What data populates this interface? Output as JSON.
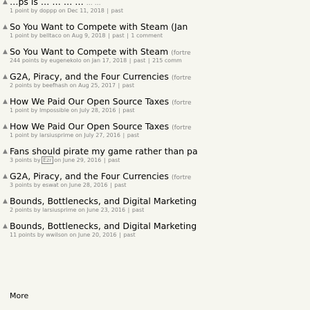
{
  "stories": [
    {
      "title": "…ps is … …  …  …",
      "site": "… …",
      "points": "1 point",
      "user": "doppp",
      "age": "on Dec 11, 2018",
      "comments": "past",
      "extra": ""
    },
    {
      "title": "So You Want to Compete with Steam (Jan",
      "site": "",
      "points": "1 point",
      "user": "belltaco",
      "age": "on Aug 9, 2018",
      "comments": "past",
      "extra": "1 comment"
    },
    {
      "title": "So You Want to Compete with Steam",
      "site": "(fortre",
      "points": "244 points",
      "user": "eugenekolo",
      "age": "on Jan 17, 2018",
      "comments": "past",
      "extra": "215 comm"
    },
    {
      "title": "G2A, Piracy, and the Four Currencies",
      "site": "(fortre",
      "points": "2 points",
      "user": "beefhash",
      "age": "on Aug 25, 2017",
      "comments": "past",
      "extra": ""
    },
    {
      "title": "How We Paid Our Open Source Taxes",
      "site": "(fortre",
      "points": "1 point",
      "user": "Impossible",
      "age": "on July 28, 2016",
      "comments": "past",
      "extra": ""
    },
    {
      "title": "How We Paid Our Open Source Taxes",
      "site": "(fortre",
      "points": "1 point",
      "user": "larsiusprime",
      "age": "on July 27, 2016",
      "comments": "past",
      "extra": ""
    },
    {
      "title": "Fans should pirate my game rather than pa",
      "site": "",
      "points": "3 points",
      "user": "Ezr",
      "age": "on June 29, 2016",
      "comments": "past",
      "extra": "",
      "user_highlight": true
    },
    {
      "title": "G2A, Piracy, and the Four Currencies",
      "site": "(fortre",
      "points": "3 points",
      "user": "eswat",
      "age": "on June 28, 2016",
      "comments": "past",
      "extra": ""
    },
    {
      "title": "Bounds, Bottlenecks, and Digital Marketing",
      "site": "",
      "points": "2 points",
      "user": "larsiusprime",
      "age": "on June 23, 2016",
      "comments": "past",
      "extra": ""
    },
    {
      "title": "Bounds, Bottlenecks, and Digital Marketing",
      "site": "",
      "points": "11 points",
      "user": "wwilson",
      "age": "on June 20, 2016",
      "comments": "past",
      "extra": ""
    }
  ],
  "more_label": "More",
  "labels": {
    "by": "by",
    "sep": "|"
  },
  "icons": {
    "upvote": "upvote-arrow-icon"
  },
  "colors": {
    "background": "#f6f6ef",
    "meta": "#828282",
    "title": "#000000"
  }
}
